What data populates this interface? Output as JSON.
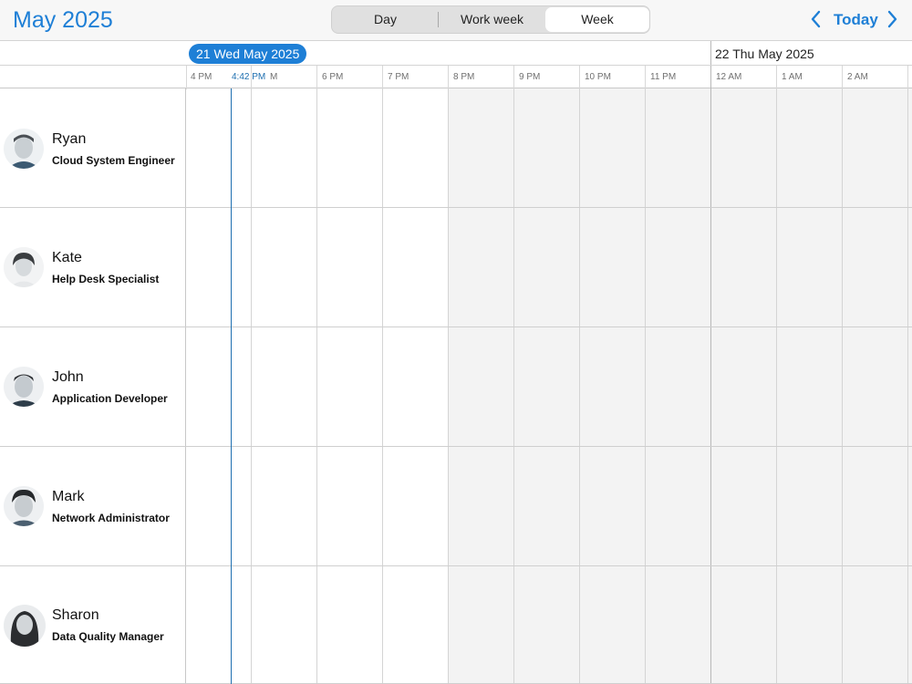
{
  "header": {
    "title": "May 2025",
    "views": [
      "Day",
      "Work week",
      "Week"
    ],
    "selected_view": "Week",
    "today_label": "Today"
  },
  "dates": {
    "day1": "21 Wed May 2025",
    "day2": "22 Thu May 2025"
  },
  "hours": [
    "4 PM",
    "M",
    "6 PM",
    "7 PM",
    "8 PM",
    "9 PM",
    "10 PM",
    "11 PM",
    "12 AM",
    "1 AM",
    "2 AM"
  ],
  "now_time": "4:42 PM",
  "resources": [
    {
      "name": "Ryan",
      "role": "Cloud System Engineer"
    },
    {
      "name": "Kate",
      "role": "Help Desk Specialist"
    },
    {
      "name": "John",
      "role": "Application Developer"
    },
    {
      "name": "Mark",
      "role": "Network Administrator"
    },
    {
      "name": "Sharon",
      "role": "Data Quality Manager"
    }
  ],
  "colors": {
    "accent": "#1e7fd6",
    "now_line": "#1e6fb0",
    "offhours": "#f3f3f3"
  }
}
